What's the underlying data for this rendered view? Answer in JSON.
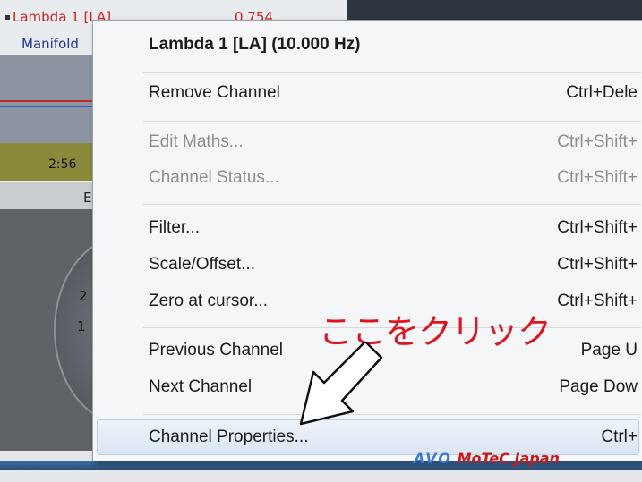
{
  "background": {
    "legend": [
      {
        "name": "Lambda 1 [LA]",
        "value": "0.754",
        "color": "#d61c1c"
      },
      {
        "name": "Manifold",
        "color": "#2233a0"
      }
    ],
    "time_label": "2:56",
    "tab_letter": "E",
    "gauge_labels": [
      "2",
      "1"
    ]
  },
  "menu": {
    "header": "Lambda 1 [LA] (10.000 Hz)",
    "items": [
      {
        "label": "Remove Channel",
        "shortcut": "Ctrl+Dele",
        "enabled": true
      },
      {
        "label": "Edit Maths...",
        "shortcut": "Ctrl+Shift+",
        "enabled": false
      },
      {
        "label": "Channel Status...",
        "shortcut": "Ctrl+Shift+",
        "enabled": false
      },
      {
        "label": "Filter...",
        "shortcut": "Ctrl+Shift+",
        "enabled": true
      },
      {
        "label": "Scale/Offset...",
        "shortcut": "Ctrl+Shift+",
        "enabled": true
      },
      {
        "label": "Zero at cursor...",
        "shortcut": "Ctrl+Shift+",
        "enabled": true
      },
      {
        "label": "Previous Channel",
        "shortcut": "Page U",
        "enabled": true
      },
      {
        "label": "Next Channel",
        "shortcut": "Page Dow",
        "enabled": true
      },
      {
        "label": "Channel Properties...",
        "shortcut": "Ctrl+",
        "enabled": true,
        "highlighted": true
      }
    ]
  },
  "annotation": {
    "text": "ここをクリック",
    "color": "#e0141c",
    "arrow_icon": "arrow-icon"
  },
  "logo": {
    "avo": "AVO",
    "motec": "MoTeC Japan"
  }
}
